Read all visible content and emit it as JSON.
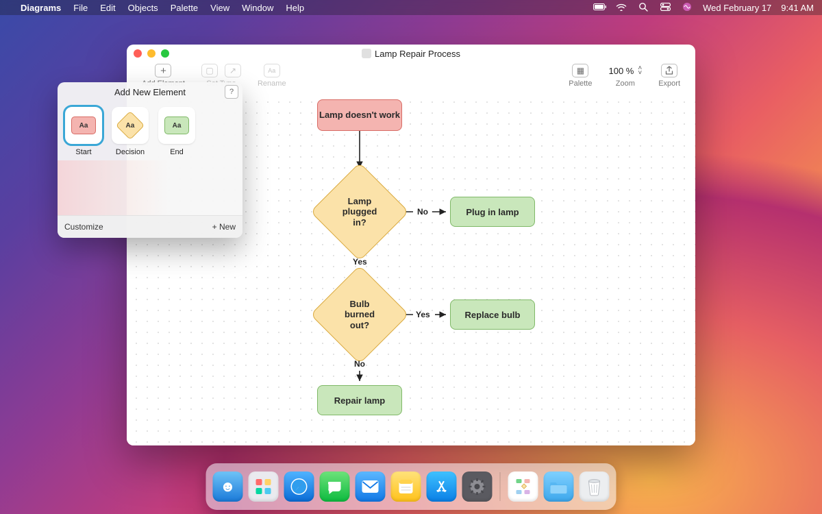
{
  "menubar": {
    "app": "Diagrams",
    "items": [
      "File",
      "Edit",
      "Objects",
      "Palette",
      "View",
      "Window",
      "Help"
    ],
    "date": "Wed February 17",
    "time": "9:41 AM"
  },
  "window": {
    "title": "Lamp Repair Process"
  },
  "toolbar": {
    "add_label": "Add Element",
    "settype_label": "Set Type",
    "rename_label": "Rename",
    "palette_label": "Palette",
    "zoom_label": "Zoom",
    "zoom_value": "100 %",
    "export_label": "Export"
  },
  "popover": {
    "title": "Add New Element",
    "items": [
      {
        "label": "Start",
        "placeholder": "Aa"
      },
      {
        "label": "Decision",
        "placeholder": "Aa"
      },
      {
        "label": "End",
        "placeholder": "Aa"
      }
    ],
    "customize": "Customize",
    "new": "+ New"
  },
  "flow": {
    "start": "Lamp doesn't work",
    "decision1": "Lamp plugged in?",
    "decision1_no": "No",
    "decision1_yes": "Yes",
    "end1": "Plug in lamp",
    "decision2": "Bulb burned out?",
    "decision2_yes": "Yes",
    "decision2_no": "No",
    "end2": "Replace bulb",
    "end3": "Repair lamp"
  },
  "dock": {
    "items": [
      "finder",
      "launchpad",
      "safari",
      "messages",
      "mail",
      "notes",
      "appstore",
      "settings",
      "diagrams",
      "files",
      "trash"
    ]
  }
}
